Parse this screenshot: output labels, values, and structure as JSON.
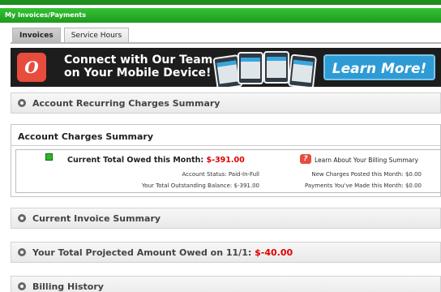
{
  "header": {
    "title": "My Invoices/Payments"
  },
  "tabs": [
    {
      "label": "Invoices",
      "active": true
    },
    {
      "label": "Service Hours",
      "active": false
    }
  ],
  "banner": {
    "logo_glyph": "O",
    "headline_line1": "Connect with Our Team",
    "headline_line2": "on Your Mobile Device!",
    "cta": "Learn More!"
  },
  "sections": {
    "recurring": "Account Recurring Charges Summary",
    "charges_title": "Account Charges Summary",
    "current_invoice": "Current Invoice Summary",
    "projected_label": "Your Total Projected Amount Owed on 11/1:",
    "projected_amount": "$-40.00",
    "billing_history": "Billing History"
  },
  "charges": {
    "owed_label": "Current Total Owed this Month:",
    "owed_amount": "$-391.00",
    "status": "Account Status: Paid-In-Full",
    "outstanding": "Your Total Outstanding Balance: $-391.00",
    "learn_link": "Learn About Your Billing Summary",
    "new_charges": "New Charges Posted this Month: $0.00",
    "payments": "Payments You've Made this Month: $0.00"
  },
  "colors": {
    "accent_green": "#1f9a1f",
    "alert_red": "#e00000",
    "cta_blue": "#2f9bd4"
  }
}
